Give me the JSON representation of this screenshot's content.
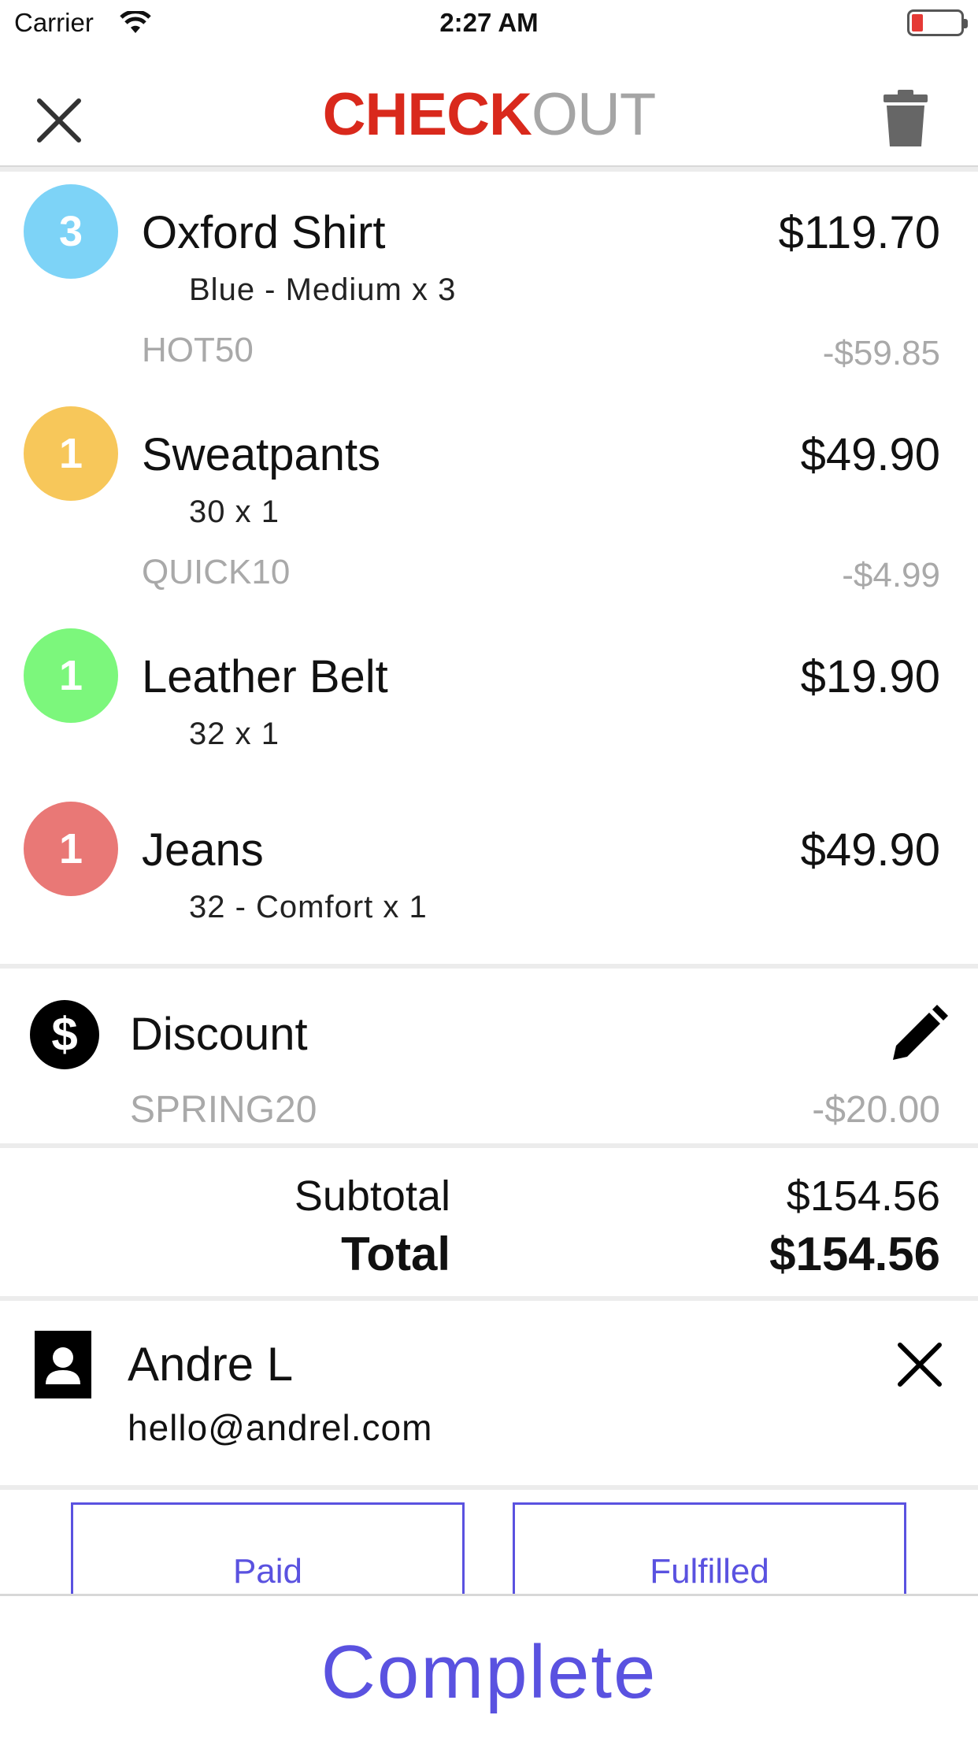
{
  "status_bar": {
    "carrier": "Carrier",
    "time": "2:27 AM"
  },
  "nav": {
    "title_part1": "CHECK",
    "title_part2": "OUT"
  },
  "items": [
    {
      "qty": "3",
      "name": "Oxford Shirt",
      "price": "$119.70",
      "variant": "Blue - Medium  x  3",
      "code": "HOT50",
      "discount": "-$59.85",
      "color": "#7dd3f7"
    },
    {
      "qty": "1",
      "name": "Sweatpants",
      "price": "$49.90",
      "variant": "30  x  1",
      "code": "QUICK10",
      "discount": "-$4.99",
      "color": "#f7c75a"
    },
    {
      "qty": "1",
      "name": "Leather Belt",
      "price": "$19.90",
      "variant": "32  x  1",
      "color": "#7cf77c"
    },
    {
      "qty": "1",
      "name": "Jeans",
      "price": "$49.90",
      "variant": "32 - Comfort  x  1",
      "color": "#e97876"
    }
  ],
  "discount": {
    "label": "Discount",
    "code": "SPRING20",
    "amount": "-$20.00",
    "icon": "dollar-icon"
  },
  "totals": {
    "subtotal_label": "Subtotal",
    "subtotal": "$154.56",
    "total_label": "Total",
    "total": "$154.56"
  },
  "customer": {
    "name": "Andre L",
    "email": "hello@andrel.com"
  },
  "buttons": {
    "paid": "Paid",
    "fulfilled": "Fulfilled",
    "complete": "Complete"
  },
  "colors": {
    "accent": "#5a52e0",
    "brand_red": "#d9291c"
  }
}
